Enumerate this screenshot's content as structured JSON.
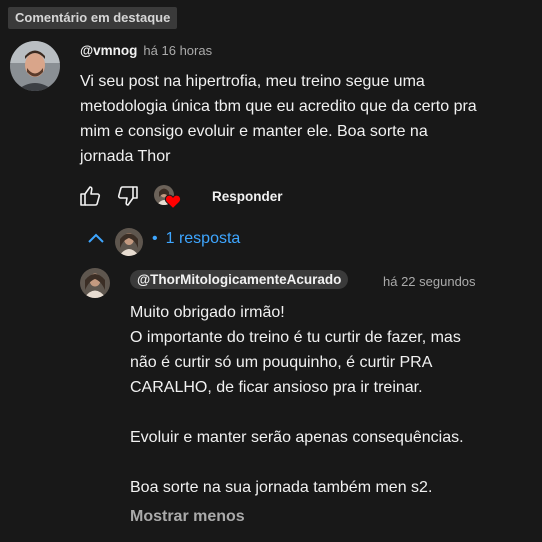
{
  "badge": "Comentário em destaque",
  "comment": {
    "author": "@vmnog",
    "time": "há 16 horas",
    "text": "Vi seu post na hipertrofia, meu treino segue uma\nmetodologia única tbm que eu acredito que da certo pra\nmim e consigo evoluir e manter ele. Boa sorte na\njornada Thor",
    "reply_label": "Responder"
  },
  "replies_toggle": {
    "dot": "•",
    "count_label": "1 resposta"
  },
  "reply": {
    "author": "@ThorMitologicamenteAcurado",
    "time": "há 22 segundos",
    "text": "Muito obrigado irmão!\nO importante do treino é tu curtir de fazer, mas\nnão é curtir só um pouquinho, é curtir PRA\nCARALHO, de ficar ansioso pra ir treinar.\n\nEvoluir e manter serão apenas consequências.\n\nBoa sorte na sua jornada também men s2.",
    "show_less": "Mostrar menos"
  },
  "icons": {
    "like": "thumbs-up-icon",
    "dislike": "thumbs-down-icon",
    "heart": "heart-icon",
    "collapse": "chevron-up-icon"
  },
  "colors": {
    "background": "#181818",
    "link": "#3ea6ff",
    "heart": "#ff0000",
    "badge_bg": "#3a3a3a"
  }
}
